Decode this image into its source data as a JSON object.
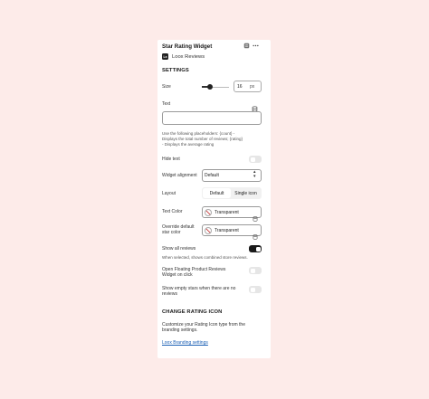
{
  "header": {
    "title": "Star Rating Widget",
    "app_logo_text": "Lx",
    "app_name": "Loox Reviews"
  },
  "settings": {
    "heading": "SETTINGS",
    "size": {
      "label": "Size",
      "value": "16",
      "unit": "px",
      "slider_fraction": 0.25
    },
    "text": {
      "label": "Text",
      "value": "",
      "hint_lines": [
        "Use the following placeholders: {count} -",
        "Displays the total number of reviews; {rating}",
        "- Displays the average rating"
      ]
    },
    "hide_text": {
      "label": "Hide text",
      "on": false
    },
    "widget_alignment": {
      "label": "Widget alignment",
      "value": "Default"
    },
    "layout": {
      "label": "Layout",
      "options": [
        "Default",
        "Single icon"
      ],
      "selected": "Default"
    },
    "text_color": {
      "label": "Text Color",
      "value": "Transparent"
    },
    "override_star_color": {
      "label_lines": [
        "Override default",
        "star color"
      ],
      "value": "Transparent"
    },
    "show_all_reviews": {
      "label": "Show all reviews",
      "on": true,
      "hint": "When selected, shows combined store reviews."
    },
    "open_floating": {
      "label_lines": [
        "Open Floating Product Reviews",
        "Widget on click"
      ],
      "on": false
    },
    "show_empty_stars": {
      "label_lines": [
        "Show empty stars when there are no",
        "reviews"
      ],
      "on": false
    }
  },
  "change_rating_icon": {
    "heading": "CHANGE RATING ICON",
    "description_lines": [
      "Customize your Rating Icon type from the",
      "branding settings."
    ],
    "link": "Loox Branding settings"
  },
  "colors": {
    "background": "#fdebe9",
    "panel": "#ffffff",
    "link": "#1a5fb4",
    "toggle_on": "#1a1a1a"
  }
}
